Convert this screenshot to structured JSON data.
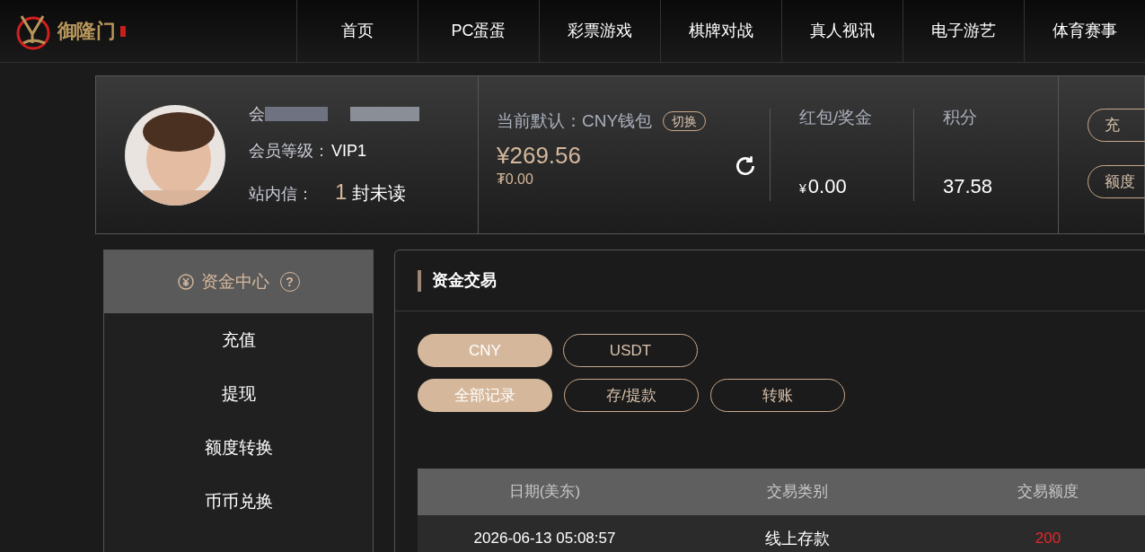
{
  "logo": {
    "text": "御隆门"
  },
  "nav": [
    "首页",
    "PC蛋蛋",
    "彩票游戏",
    "棋牌对战",
    "真人视讯",
    "电子游艺",
    "体育赛事"
  ],
  "profile": {
    "username_label": "会",
    "level_label": "会员等级：",
    "level": "VIP1",
    "messages_label": "站内信：",
    "unread_count": "1",
    "unread_text": "封未读"
  },
  "wallet": {
    "default_label": "当前默认：CNY钱包",
    "switch": "切换",
    "balance": "¥269.56",
    "sub_balance": "₮0.00"
  },
  "bonus": {
    "label": "红包/奖金",
    "currency": "¥",
    "amount": "0.00"
  },
  "points": {
    "label": "积分",
    "amount": "37.58"
  },
  "side_buttons": [
    "充",
    "额度"
  ],
  "sidebar": {
    "title": "资金中心",
    "help": "?",
    "items": [
      "充值",
      "提现",
      "额度转换",
      "币币兑换"
    ]
  },
  "panel": {
    "title": "资金交易",
    "currencies": [
      {
        "label": "CNY",
        "selected": true
      },
      {
        "label": "USDT",
        "selected": false
      }
    ],
    "filters": [
      {
        "label": "全部记录",
        "selected": true
      },
      {
        "label": "存/提款",
        "selected": false
      },
      {
        "label": "转账",
        "selected": false
      }
    ],
    "table": {
      "columns": [
        "日期(美东)",
        "交易类别",
        "交易额度"
      ],
      "rows": [
        {
          "date": "2026-06-13 05:08:57",
          "type": "线上存款",
          "amount": "200",
          "color": "#e8262a"
        }
      ]
    }
  }
}
